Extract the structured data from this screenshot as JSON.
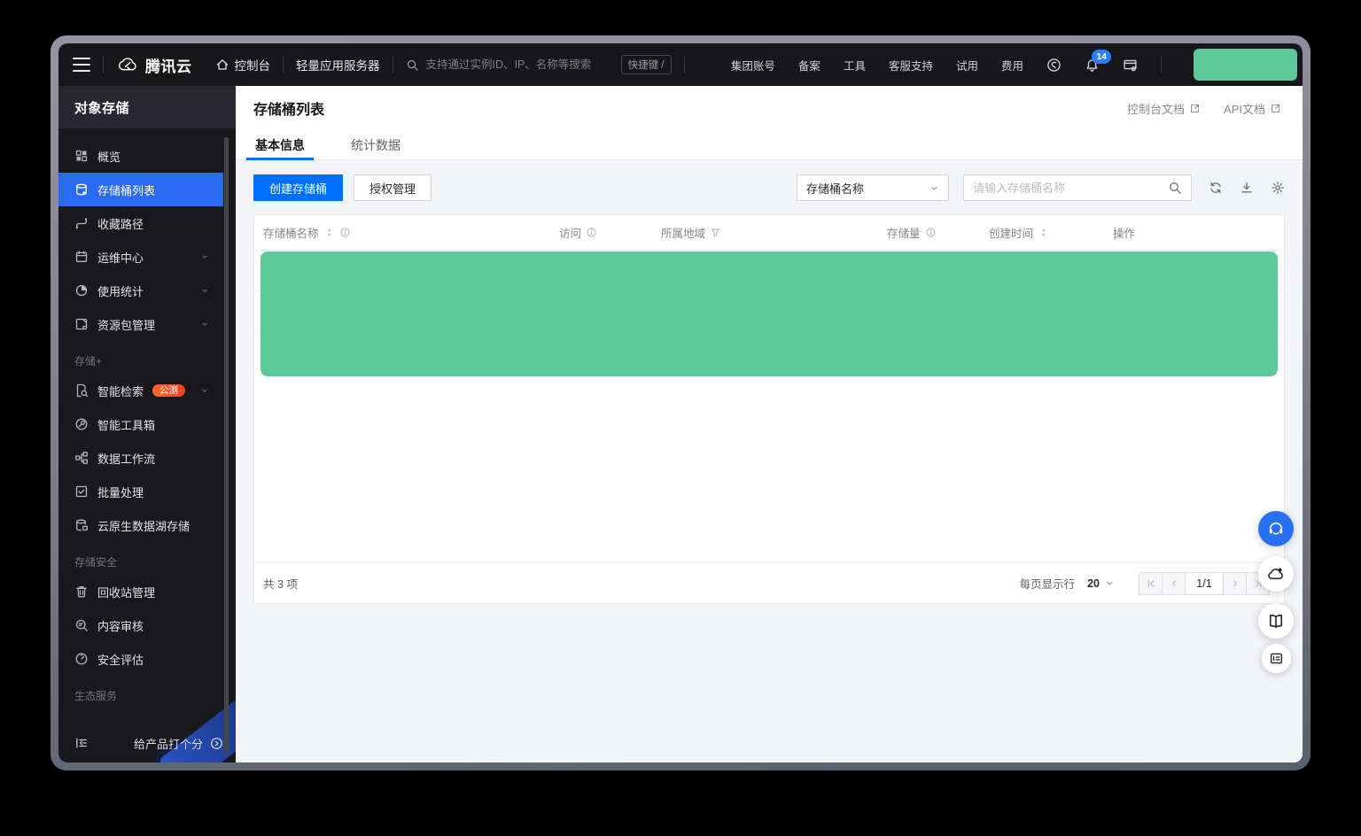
{
  "colors": {
    "accent": "#006EFF",
    "sidebar_active": "#2A6BF2",
    "green": "#5EC998",
    "beta_badge": "#FF5A26",
    "notification_badge": "#2E7DFF"
  },
  "topnav": {
    "logo_text": "腾讯云",
    "console_label": "控制台",
    "product_tab": "轻量应用服务器",
    "search_placeholder": "支持通过实例ID、IP、名称等搜索",
    "shortcut_label": "快捷键 /",
    "menu_items": [
      "集团账号",
      "备案",
      "工具",
      "客服支持",
      "试用",
      "费用"
    ],
    "notification_count": "14"
  },
  "sidebar": {
    "title": "对象存储",
    "groups": [
      {
        "label": "",
        "items": [
          {
            "label": "概览",
            "icon": "grid-icon"
          },
          {
            "label": "存储桶列表",
            "icon": "bucket-icon",
            "active": true
          },
          {
            "label": "收藏路径",
            "icon": "route-icon"
          },
          {
            "label": "运维中心",
            "icon": "calendar-icon",
            "expandable": true
          },
          {
            "label": "使用统计",
            "icon": "pie-icon",
            "expandable": true
          },
          {
            "label": "资源包管理",
            "icon": "package-icon",
            "expandable": true
          }
        ]
      },
      {
        "label": "存储+",
        "items": [
          {
            "label": "智能检索",
            "icon": "doc-search-icon",
            "badge": "公测",
            "expandable": true
          },
          {
            "label": "智能工具箱",
            "icon": "toolbox-icon"
          },
          {
            "label": "数据工作流",
            "icon": "workflow-icon"
          },
          {
            "label": "批量处理",
            "icon": "batch-icon"
          },
          {
            "label": "云原生数据湖存储",
            "icon": "datalake-icon"
          }
        ]
      },
      {
        "label": "存储安全",
        "items": [
          {
            "label": "回收站管理",
            "icon": "trash-icon"
          },
          {
            "label": "内容审核",
            "icon": "audit-icon"
          },
          {
            "label": "安全评估",
            "icon": "gauge-icon"
          }
        ]
      },
      {
        "label": "生态服务",
        "items": []
      }
    ],
    "rate_label": "给产品打个分"
  },
  "main": {
    "page_title": "存储桶列表",
    "doc_links": [
      {
        "label": "控制台文档"
      },
      {
        "label": "API文档"
      }
    ],
    "tabs": [
      {
        "label": "基本信息",
        "active": true
      },
      {
        "label": "统计数据",
        "active": false
      }
    ],
    "toolbar": {
      "create_button": "创建存储桶",
      "auth_button": "授权管理",
      "filter_select_value": "存储桶名称",
      "search_placeholder": "请输入存储桶名称"
    },
    "table": {
      "columns": [
        {
          "label": "存储桶名称",
          "sort": true,
          "info": true
        },
        {
          "label": "访问",
          "info": true
        },
        {
          "label": "所属地域",
          "filter": true
        },
        {
          "label": "存储量",
          "info": true
        },
        {
          "label": "创建时间",
          "sort": true
        },
        {
          "label": "操作"
        }
      ],
      "masked_rows": 3
    },
    "footer": {
      "total": "共 3 项",
      "per_page_label": "每页显示行",
      "per_page_value": "20",
      "page_indicator": "1/1"
    }
  },
  "floating_buttons": [
    {
      "name": "support",
      "icon": "headset-icon"
    },
    {
      "name": "cloud-assistant",
      "icon": "cloud-badge-icon"
    },
    {
      "name": "documentation",
      "icon": "book-icon"
    },
    {
      "name": "feedback",
      "icon": "feedback-icon"
    }
  ]
}
